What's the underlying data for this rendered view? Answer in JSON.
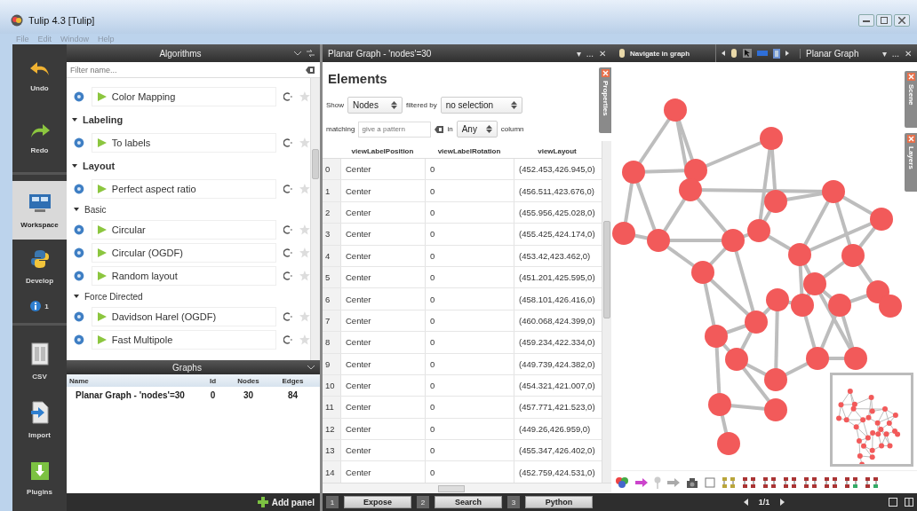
{
  "window": {
    "title": "Tulip 4.3 [Tulip]"
  },
  "menu": [
    "File",
    "Edit",
    "Window",
    "Help"
  ],
  "sidebar": {
    "items": [
      {
        "kind": "undo",
        "label": "Undo",
        "selected": false
      },
      {
        "kind": "redo",
        "label": "Redo",
        "selected": false
      },
      {
        "kind": "workspace",
        "label": "Workspace",
        "selected": true
      },
      {
        "kind": "develop",
        "label": "Develop",
        "selected": false
      },
      {
        "kind": "info",
        "label": "1",
        "selected": false
      },
      {
        "kind": "csv",
        "label": "CSV",
        "selected": false
      },
      {
        "kind": "import",
        "label": "Import",
        "selected": false
      },
      {
        "kind": "plugins",
        "label": "Plugins",
        "selected": false
      }
    ]
  },
  "algorithms": {
    "title": "Algorithms",
    "filter": {
      "placeholder": "Filter name..."
    },
    "items": [
      {
        "kind": "algorithm",
        "label": "Color Mapping"
      },
      {
        "kind": "category",
        "label": "Labeling",
        "expanded": true,
        "children": [
          {
            "kind": "algorithm",
            "label": "To labels"
          }
        ]
      },
      {
        "kind": "category",
        "label": "Layout",
        "expanded": true,
        "children": [
          {
            "kind": "algorithm",
            "label": "Perfect aspect ratio"
          },
          {
            "kind": "subcategory",
            "label": "Basic",
            "expanded": true,
            "children": [
              {
                "kind": "algorithm",
                "label": "Circular"
              },
              {
                "kind": "algorithm",
                "label": "Circular (OGDF)"
              },
              {
                "kind": "algorithm",
                "label": "Random layout"
              }
            ]
          },
          {
            "kind": "subcategory",
            "label": "Force Directed",
            "expanded": true,
            "children": [
              {
                "kind": "algorithm",
                "label": "Davidson Harel (OGDF)"
              },
              {
                "kind": "algorithm",
                "label": "Fast Multipole"
              }
            ]
          }
        ]
      }
    ]
  },
  "graphs": {
    "title": "Graphs",
    "columns": [
      "Name",
      "Id",
      "Nodes",
      "Edges"
    ],
    "rows": [
      [
        "Planar Graph - 'nodes'=30",
        "0",
        "30",
        "84"
      ]
    ]
  },
  "add_panel": "Add panel",
  "table_view": {
    "title": "Planar Graph - 'nodes'=30",
    "header_buttons": [
      "▾",
      "...",
      "✕"
    ],
    "heading": "Elements",
    "show_label": "Show",
    "show": "Nodes",
    "filtered_label": "filtered by",
    "filter": "no selection",
    "matching_label": "matching",
    "pattern": {
      "placeholder": "give a pattern"
    },
    "in_label": "in",
    "column_select": "Any",
    "column_label": "column",
    "side_tab": "Properties",
    "columns": [
      "viewLabelPosition",
      "viewLabelRotation",
      "viewLayout"
    ],
    "rows": [
      {
        "index": "0",
        "cells": [
          "Center",
          "0",
          "(452.453,426.945,0)"
        ]
      },
      {
        "index": "1",
        "cells": [
          "Center",
          "0",
          "(456.511,423.676,0)"
        ]
      },
      {
        "index": "2",
        "cells": [
          "Center",
          "0",
          "(455.956,425.028,0)"
        ]
      },
      {
        "index": "3",
        "cells": [
          "Center",
          "0",
          "(455.425,424.174,0)"
        ]
      },
      {
        "index": "4",
        "cells": [
          "Center",
          "0",
          "(453.42,423.462,0)"
        ]
      },
      {
        "index": "5",
        "cells": [
          "Center",
          "0",
          "(451.201,425.595,0)"
        ]
      },
      {
        "index": "6",
        "cells": [
          "Center",
          "0",
          "(458.101,426.416,0)"
        ]
      },
      {
        "index": "7",
        "cells": [
          "Center",
          "0",
          "(460.068,424.399,0)"
        ]
      },
      {
        "index": "8",
        "cells": [
          "Center",
          "0",
          "(459.234,422.334,0)"
        ]
      },
      {
        "index": "9",
        "cells": [
          "Center",
          "0",
          "(449.739,424.382,0)"
        ]
      },
      {
        "index": "10",
        "cells": [
          "Center",
          "0",
          "(454.321,421.007,0)"
        ]
      },
      {
        "index": "11",
        "cells": [
          "Center",
          "0",
          "(457.771,421.523,0)"
        ]
      },
      {
        "index": "12",
        "cells": [
          "Center",
          "0",
          "(449.26,426.959,0)"
        ]
      },
      {
        "index": "13",
        "cells": [
          "Center",
          "0",
          "(455.347,426.402,0)"
        ]
      },
      {
        "index": "14",
        "cells": [
          "Center",
          "0",
          "(452.759,424.531,0)"
        ]
      }
    ]
  },
  "bottom_tabs": [
    {
      "number": "1",
      "label": "Expose"
    },
    {
      "number": "2",
      "label": "Search"
    },
    {
      "number": "3",
      "label": "Python"
    }
  ],
  "graph_view": {
    "mode": "Navigate in graph",
    "view_select": "Planar Graph",
    "header_buttons": [
      "▾",
      "...",
      "✕"
    ],
    "side_tabs": [
      "Scene",
      "Layers"
    ],
    "page": "1/1"
  }
}
